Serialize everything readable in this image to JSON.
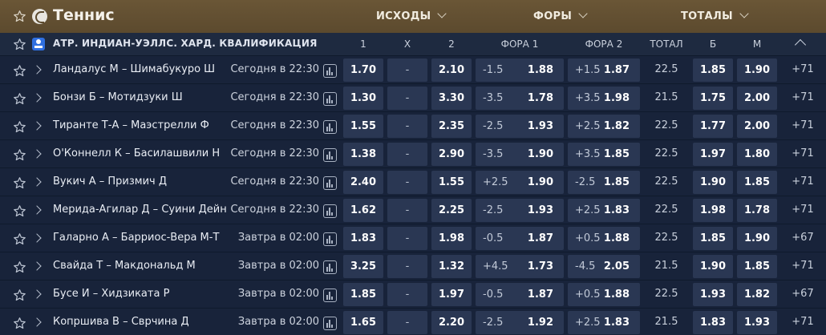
{
  "header": {
    "title": "Теннис",
    "groups": [
      {
        "label": "ИСХОДЫ"
      },
      {
        "label": "ФОРЫ"
      },
      {
        "label": "ТОТАЛЫ"
      }
    ]
  },
  "league": {
    "name": "АТР. ИНДИАН-УЭЛЛС. ХАРД. КВАЛИФИКАЦИЯ",
    "columns": [
      "1",
      "Х",
      "2",
      "ФОРА 1",
      "ФОРА 2",
      "ТОТАЛ",
      "Б",
      "М"
    ]
  },
  "icons": {
    "favorite": "star-outline-icon",
    "sport": "tennis-ball-icon",
    "league": "tournament-badge-icon",
    "expand": "chevron-right-icon",
    "stats": "bar-chart-icon",
    "collapse": "chevron-up-icon"
  },
  "colors": {
    "header_bg": "#5c4a2e",
    "row_bg": "#18233a",
    "cell_bg": "#2a3753",
    "page_bg": "#0f1a2c",
    "league_icon": "#2f6fe0"
  },
  "events": [
    {
      "match": "Ландалус М – Шимабукуро Ш",
      "time": "Сегодня в 22:30",
      "p1": "1.70",
      "x": "-",
      "p2": "2.10",
      "h1": "-1.5",
      "h1o": "1.88",
      "h2": "+1.5",
      "h2o": "1.87",
      "total": "22.5",
      "over": "1.85",
      "under": "1.90",
      "more": "+71"
    },
    {
      "match": "Бонзи Б – Мотидзуки Ш",
      "time": "Сегодня в 22:30",
      "p1": "1.30",
      "x": "-",
      "p2": "3.30",
      "h1": "-3.5",
      "h1o": "1.78",
      "h2": "+3.5",
      "h2o": "1.98",
      "total": "21.5",
      "over": "1.75",
      "under": "2.00",
      "more": "+71"
    },
    {
      "match": "Тиранте Т-А – Маэстрелли Ф",
      "time": "Сегодня в 22:30",
      "p1": "1.55",
      "x": "-",
      "p2": "2.35",
      "h1": "-2.5",
      "h1o": "1.93",
      "h2": "+2.5",
      "h2o": "1.82",
      "total": "22.5",
      "over": "1.77",
      "under": "2.00",
      "more": "+71"
    },
    {
      "match": "О'Коннелл К – Басилашвили Н",
      "time": "Сегодня в 22:30",
      "p1": "1.38",
      "x": "-",
      "p2": "2.90",
      "h1": "-3.5",
      "h1o": "1.90",
      "h2": "+3.5",
      "h2o": "1.85",
      "total": "22.5",
      "over": "1.97",
      "under": "1.80",
      "more": "+71"
    },
    {
      "match": "Вукич А – Призмич Д",
      "time": "Сегодня в 22:30",
      "p1": "2.40",
      "x": "-",
      "p2": "1.55",
      "h1": "+2.5",
      "h1o": "1.90",
      "h2": "-2.5",
      "h2o": "1.85",
      "total": "22.5",
      "over": "1.90",
      "under": "1.85",
      "more": "+71"
    },
    {
      "match": "Мерида-Агилар Д – Суини Дейн",
      "time": "Сегодня в 22:30",
      "p1": "1.62",
      "x": "-",
      "p2": "2.25",
      "h1": "-2.5",
      "h1o": "1.93",
      "h2": "+2.5",
      "h2o": "1.83",
      "total": "22.5",
      "over": "1.98",
      "under": "1.78",
      "more": "+71"
    },
    {
      "match": "Галарно А – Барриос-Вера М-Т",
      "time": "Завтра в 02:00",
      "p1": "1.83",
      "x": "-",
      "p2": "1.98",
      "h1": "-0.5",
      "h1o": "1.87",
      "h2": "+0.5",
      "h2o": "1.88",
      "total": "22.5",
      "over": "1.85",
      "under": "1.90",
      "more": "+67"
    },
    {
      "match": "Свайда Т – Макдональд М",
      "time": "Завтра в 02:00",
      "p1": "3.25",
      "x": "-",
      "p2": "1.32",
      "h1": "+4.5",
      "h1o": "1.73",
      "h2": "-4.5",
      "h2o": "2.05",
      "total": "21.5",
      "over": "1.90",
      "under": "1.85",
      "more": "+71"
    },
    {
      "match": "Бусе И – Хидзиката Р",
      "time": "Завтра в 02:00",
      "p1": "1.85",
      "x": "-",
      "p2": "1.97",
      "h1": "-0.5",
      "h1o": "1.87",
      "h2": "+0.5",
      "h2o": "1.88",
      "total": "22.5",
      "over": "1.93",
      "under": "1.82",
      "more": "+67"
    },
    {
      "match": "Копршива В – Сврчина Д",
      "time": "Завтра в 02:00",
      "p1": "1.65",
      "x": "-",
      "p2": "2.20",
      "h1": "-2.5",
      "h1o": "1.92",
      "h2": "+2.5",
      "h2o": "1.83",
      "total": "21.5",
      "over": "1.83",
      "under": "1.93",
      "more": "+71"
    }
  ]
}
